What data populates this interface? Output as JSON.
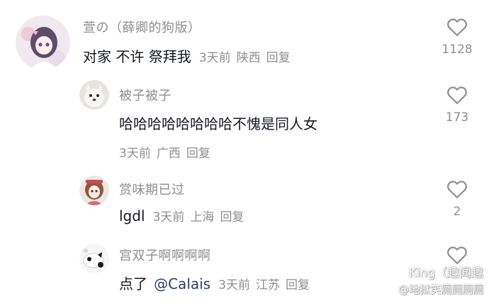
{
  "comments": [
    {
      "name": "萱の（薛卿的狗版）",
      "text": "对家 不许 祭拜我",
      "time": "3天前",
      "location": "陕西",
      "reply": "回复",
      "likes": "1128"
    },
    {
      "name": "被子被子",
      "text": "哈哈哈哈哈哈哈哈不愧是同人女",
      "time": "3天前",
      "location": "广西",
      "reply": "回复",
      "likes": "173"
    },
    {
      "name": "赏味期已过",
      "text": "lgdl",
      "time": "3天前",
      "location": "上海",
      "reply": "回复",
      "likes": "2"
    },
    {
      "name": "宫双子啊啊啊啊",
      "text_prefix": "点了",
      "mention": "@Calais",
      "time": "3天前",
      "location": "江苏",
      "reply": "回复"
    }
  ],
  "watermark": {
    "line1": "King（趣闻趣",
    "line2": "@地狱笑厕厕厕厕"
  },
  "colors": {
    "text": "#161823",
    "meta": "#8e8e93",
    "mention": "#2b3e68",
    "heart": "#8e8e93"
  },
  "icons": {
    "like": "heart-outline-icon"
  }
}
